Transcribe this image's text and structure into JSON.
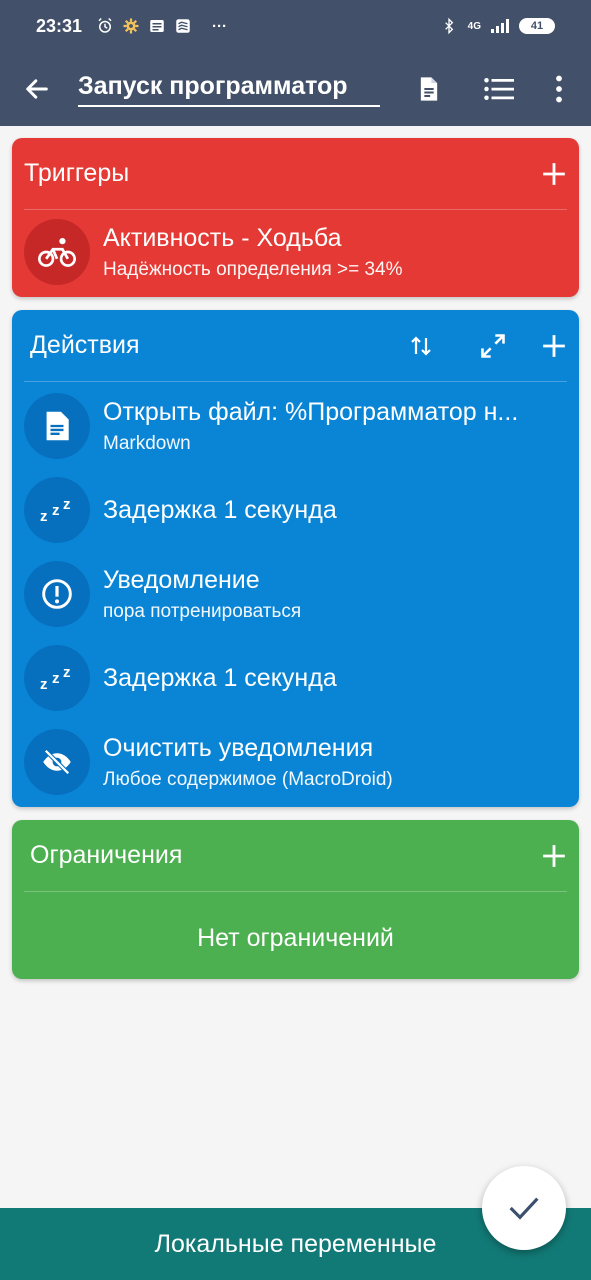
{
  "status_bar": {
    "time": "23:31",
    "network": "4G",
    "battery": "41",
    "more_indicator": "···"
  },
  "toolbar": {
    "title": "Запуск программатор",
    "back_icon": "arrow-left-icon",
    "doc_icon": "document-icon",
    "list_icon": "list-icon",
    "more_icon": "more-vert-icon"
  },
  "triggers": {
    "title": "Триггеры",
    "color": "#e53935",
    "items": [
      {
        "icon": "bicycle-icon",
        "title": "Активность - Ходьба",
        "subtitle": "Надёжность определения >= 34%"
      }
    ]
  },
  "actions": {
    "title": "Действия",
    "color": "#0a85d6",
    "items": [
      {
        "icon": "file-icon",
        "title": "Открыть файл: %Программатор н...",
        "subtitle": "Markdown"
      },
      {
        "icon": "sleep-zzz-icon",
        "title": "Задержка 1 секунда",
        "subtitle": ""
      },
      {
        "icon": "alert-circle-icon",
        "title": "Уведомление",
        "subtitle": "пора потренироваться"
      },
      {
        "icon": "sleep-zzz-icon",
        "title": "Задержка 1 секунда",
        "subtitle": ""
      },
      {
        "icon": "eye-off-icon",
        "title": "Очистить уведомления",
        "subtitle": "Любое содержимое (MacroDroid)"
      }
    ]
  },
  "constraints": {
    "title": "Ограничения",
    "color": "#4caf50",
    "empty_text": "Нет ограничений"
  },
  "bottom_bar": {
    "label": "Локальные переменные",
    "color": "#127a76"
  },
  "fab": {
    "icon": "check-icon"
  }
}
